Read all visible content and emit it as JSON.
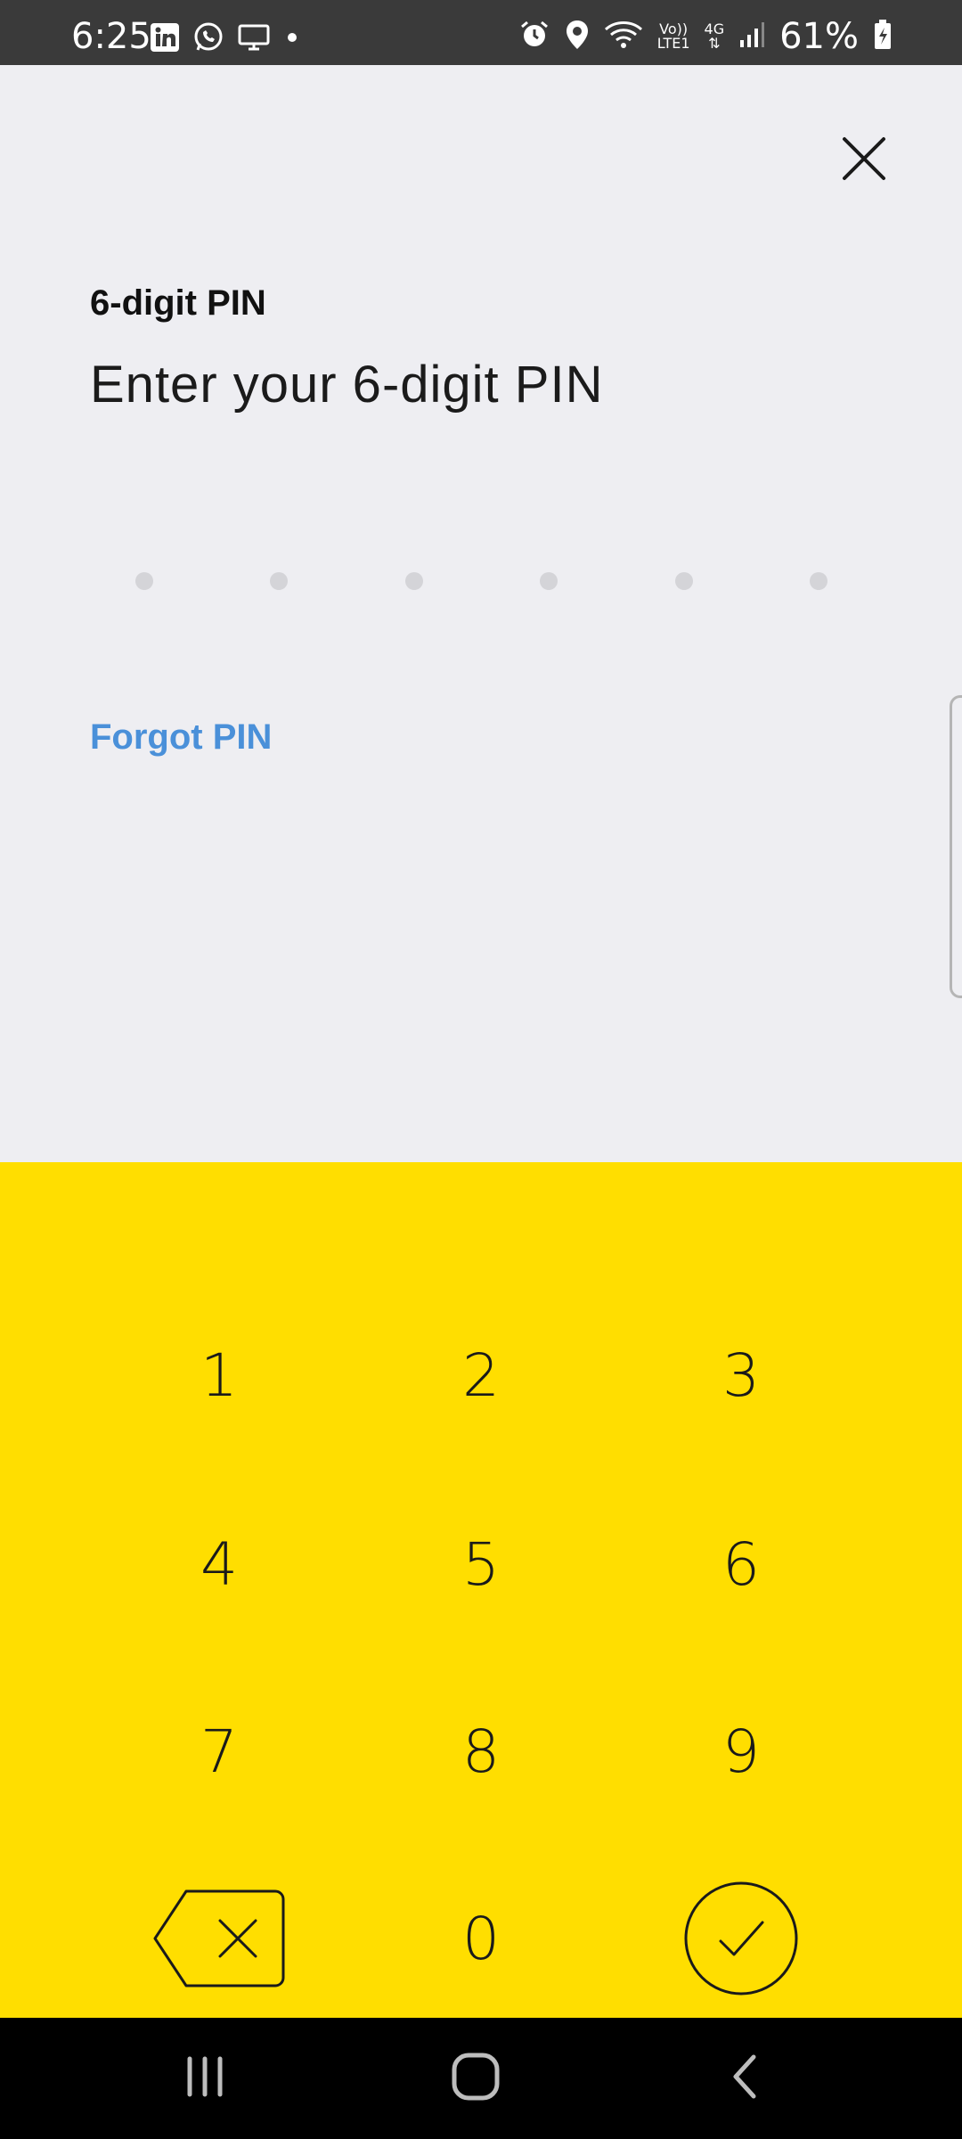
{
  "status_bar": {
    "time": "6:25",
    "battery": "61%",
    "network_label_top": "Vo))",
    "network_label_bottom": "LTE1",
    "network_type": "4G",
    "left_icons": [
      "linkedin-icon",
      "whatsapp-icon",
      "screen-icon",
      "dot-icon"
    ],
    "right_icons": [
      "alarm-icon",
      "location-icon",
      "wifi-icon",
      "signal-icon",
      "battery-icon"
    ]
  },
  "header": {
    "close_icon": "close-icon"
  },
  "pin": {
    "label": "6-digit PIN",
    "title": "Enter your 6-digit PIN",
    "dot_count": 6,
    "entered": 0
  },
  "forgot_label": "Forgot PIN",
  "keypad": {
    "keys": [
      "1",
      "2",
      "3",
      "4",
      "5",
      "6",
      "7",
      "8",
      "9",
      "0"
    ],
    "backspace_icon": "backspace-icon",
    "confirm_icon": "check-icon",
    "background_color": "#FFDE00"
  },
  "nav_bar": {
    "icons": [
      "recents-icon",
      "home-icon",
      "back-icon"
    ]
  },
  "colors": {
    "background": "#EEEEF2",
    "accent_link": "#4A90D9",
    "keypad": "#FFDE00"
  }
}
